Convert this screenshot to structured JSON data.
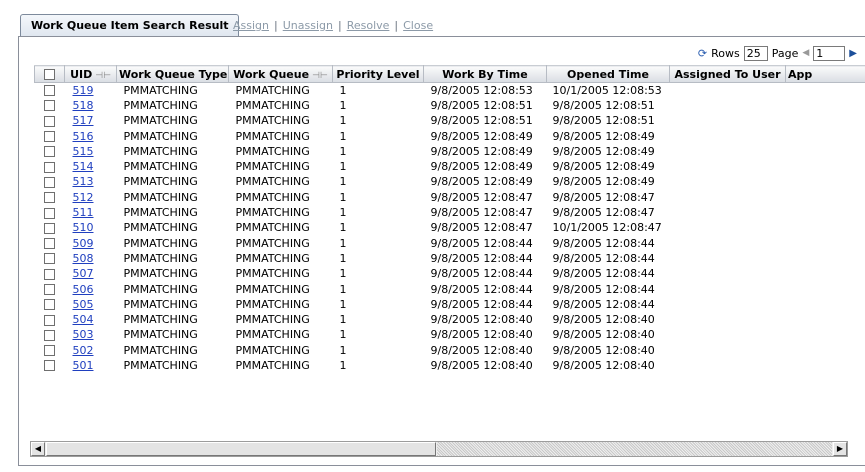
{
  "tabs": {
    "active_label": "Work Queue Item Search Result",
    "links": [
      "Assign",
      "Unassign",
      "Resolve",
      "Close"
    ]
  },
  "pager": {
    "refresh_icon": "refresh-icon",
    "rows_label": "Rows",
    "rows_value": "25",
    "page_label": "Page",
    "page_value": "1"
  },
  "table": {
    "columns": [
      "UID",
      "Work Queue Type",
      "Work Queue",
      "Priority Level",
      "Work By Time",
      "Opened Time",
      "Assigned To User",
      "App"
    ],
    "rows": [
      {
        "uid": "519",
        "type": "PMMATCHING",
        "queue": "PMMATCHING",
        "priority": "1",
        "work_by": "9/8/2005 12:08:53",
        "opened": "10/1/2005 12:08:53"
      },
      {
        "uid": "518",
        "type": "PMMATCHING",
        "queue": "PMMATCHING",
        "priority": "1",
        "work_by": "9/8/2005 12:08:51",
        "opened": "9/8/2005 12:08:51"
      },
      {
        "uid": "517",
        "type": "PMMATCHING",
        "queue": "PMMATCHING",
        "priority": "1",
        "work_by": "9/8/2005 12:08:51",
        "opened": "9/8/2005 12:08:51"
      },
      {
        "uid": "516",
        "type": "PMMATCHING",
        "queue": "PMMATCHING",
        "priority": "1",
        "work_by": "9/8/2005 12:08:49",
        "opened": "9/8/2005 12:08:49"
      },
      {
        "uid": "515",
        "type": "PMMATCHING",
        "queue": "PMMATCHING",
        "priority": "1",
        "work_by": "9/8/2005 12:08:49",
        "opened": "9/8/2005 12:08:49"
      },
      {
        "uid": "514",
        "type": "PMMATCHING",
        "queue": "PMMATCHING",
        "priority": "1",
        "work_by": "9/8/2005 12:08:49",
        "opened": "9/8/2005 12:08:49"
      },
      {
        "uid": "513",
        "type": "PMMATCHING",
        "queue": "PMMATCHING",
        "priority": "1",
        "work_by": "9/8/2005 12:08:49",
        "opened": "9/8/2005 12:08:49"
      },
      {
        "uid": "512",
        "type": "PMMATCHING",
        "queue": "PMMATCHING",
        "priority": "1",
        "work_by": "9/8/2005 12:08:47",
        "opened": "9/8/2005 12:08:47"
      },
      {
        "uid": "511",
        "type": "PMMATCHING",
        "queue": "PMMATCHING",
        "priority": "1",
        "work_by": "9/8/2005 12:08:47",
        "opened": "9/8/2005 12:08:47"
      },
      {
        "uid": "510",
        "type": "PMMATCHING",
        "queue": "PMMATCHING",
        "priority": "1",
        "work_by": "9/8/2005 12:08:47",
        "opened": "10/1/2005 12:08:47"
      },
      {
        "uid": "509",
        "type": "PMMATCHING",
        "queue": "PMMATCHING",
        "priority": "1",
        "work_by": "9/8/2005 12:08:44",
        "opened": "9/8/2005 12:08:44"
      },
      {
        "uid": "508",
        "type": "PMMATCHING",
        "queue": "PMMATCHING",
        "priority": "1",
        "work_by": "9/8/2005 12:08:44",
        "opened": "9/8/2005 12:08:44"
      },
      {
        "uid": "507",
        "type": "PMMATCHING",
        "queue": "PMMATCHING",
        "priority": "1",
        "work_by": "9/8/2005 12:08:44",
        "opened": "9/8/2005 12:08:44"
      },
      {
        "uid": "506",
        "type": "PMMATCHING",
        "queue": "PMMATCHING",
        "priority": "1",
        "work_by": "9/8/2005 12:08:44",
        "opened": "9/8/2005 12:08:44"
      },
      {
        "uid": "505",
        "type": "PMMATCHING",
        "queue": "PMMATCHING",
        "priority": "1",
        "work_by": "9/8/2005 12:08:44",
        "opened": "9/8/2005 12:08:44"
      },
      {
        "uid": "504",
        "type": "PMMATCHING",
        "queue": "PMMATCHING",
        "priority": "1",
        "work_by": "9/8/2005 12:08:40",
        "opened": "9/8/2005 12:08:40"
      },
      {
        "uid": "503",
        "type": "PMMATCHING",
        "queue": "PMMATCHING",
        "priority": "1",
        "work_by": "9/8/2005 12:08:40",
        "opened": "9/8/2005 12:08:40"
      },
      {
        "uid": "502",
        "type": "PMMATCHING",
        "queue": "PMMATCHING",
        "priority": "1",
        "work_by": "9/8/2005 12:08:40",
        "opened": "9/8/2005 12:08:40"
      },
      {
        "uid": "501",
        "type": "PMMATCHING",
        "queue": "PMMATCHING",
        "priority": "1",
        "work_by": "9/8/2005 12:08:40",
        "opened": "9/8/2005 12:08:40"
      }
    ]
  },
  "colors": {
    "link": "#1f3fbf",
    "tab_accent": "#2f5e9a",
    "disabled_link": "#8c9aa8"
  }
}
